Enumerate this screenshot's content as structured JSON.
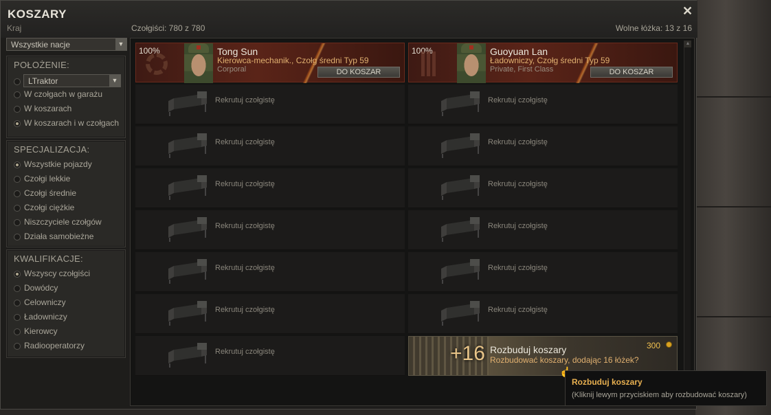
{
  "window": {
    "title": "KOSZARY",
    "subtitle": "Kraj",
    "tankmen_count": "Czołgiści: 780 z 780",
    "free_beds": "Wolne łóżka: 13 z 16",
    "close_icon": "close-icon"
  },
  "nation_filter": {
    "value": "Wszystkie nacje"
  },
  "location": {
    "title": "POŁOŻENIE:",
    "tank_select": "LTraktor",
    "options": [
      {
        "label": "W czołgach w garażu",
        "selected": false
      },
      {
        "label": "W koszarach",
        "selected": false
      },
      {
        "label": "W koszarach i w czołgach",
        "selected": true
      }
    ]
  },
  "specialization": {
    "title": "SPECJALIZACJA:",
    "options": [
      {
        "label": "Wszystkie pojazdy",
        "selected": true
      },
      {
        "label": "Czołgi lekkie",
        "selected": false
      },
      {
        "label": "Czołgi średnie",
        "selected": false
      },
      {
        "label": "Czołgi ciężkie",
        "selected": false
      },
      {
        "label": "Niszczyciele czołgów",
        "selected": false
      },
      {
        "label": "Działa samobieżne",
        "selected": false
      }
    ]
  },
  "qualification": {
    "title": "KWALIFIKACJE:",
    "options": [
      {
        "label": "Wszyscy czołgiści",
        "selected": true
      },
      {
        "label": "Dowódcy",
        "selected": false
      },
      {
        "label": "Celowniczy",
        "selected": false
      },
      {
        "label": "Ładowniczy",
        "selected": false
      },
      {
        "label": "Kierowcy",
        "selected": false
      },
      {
        "label": "Radiooperatorzy",
        "selected": false
      }
    ]
  },
  "crew": [
    {
      "percent": "100%",
      "name": "Tong Sun",
      "role": "Kierowca-mechanik., Czołg średni Typ 59",
      "rank": "Corporal",
      "button": "DO KOSZAR",
      "badge_icon": "gear-icon"
    },
    {
      "percent": "100%",
      "name": "Guoyuan Lan",
      "role": "Ładowniczy, Czołg średni Typ 59",
      "rank": "Private, First Class",
      "button": "DO KOSZAR",
      "badge_icon": "shells-icon"
    }
  ],
  "empty_slot": {
    "label": "Rekrutuj czołgistę",
    "icon": "bed-icon"
  },
  "upgrade": {
    "plus": "+16",
    "title": "Rozbuduj koszary",
    "description": "Rozbudować koszary, dodając 16 łóżek?",
    "price": "300",
    "currency_icon": "gold-coin-icon"
  },
  "tooltip": {
    "title": "Rozbuduj koszary",
    "body": "(Kliknij lewym przyciskiem aby rozbudować koszary)"
  },
  "colors": {
    "accent": "#e0b070",
    "crew_card": "#5a2418",
    "tooltip_title": "#e8b050",
    "gold": "#f0c050"
  }
}
